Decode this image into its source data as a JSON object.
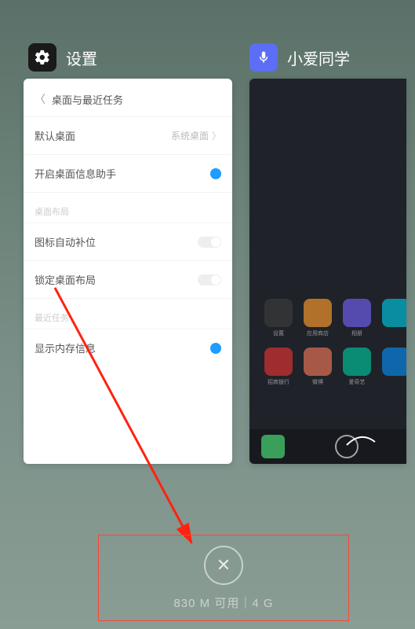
{
  "apps": {
    "left": {
      "name": "设置"
    },
    "right": {
      "name": "小爱同学"
    }
  },
  "settings": {
    "page_title": "桌面与最近任务",
    "default_desktop": {
      "label": "默认桌面",
      "value": "系统桌面"
    },
    "info_assistant": {
      "label": "开启桌面信息助手"
    },
    "section1": "桌面布局",
    "auto_fill": {
      "label": "图标自动补位"
    },
    "lock_layout": {
      "label": "锁定桌面布局"
    },
    "section2": "最近任务",
    "show_memory": {
      "label": "显示内存信息"
    }
  },
  "homescreen": {
    "icons": [
      {
        "label": "设置",
        "color": "#3a3a3a"
      },
      {
        "label": "应用商店",
        "color": "#f0932b"
      },
      {
        "label": "相册",
        "color": "#6c5ce7"
      },
      {
        "label": "",
        "color": "#00bcd4"
      },
      {
        "label": "招商银行",
        "color": "#d63031"
      },
      {
        "label": "微博",
        "color": "#e17055"
      },
      {
        "label": "爱奇艺",
        "color": "#00b894"
      },
      {
        "label": "",
        "color": "#0984e3"
      }
    ]
  },
  "footer": {
    "memory": "830 M 可用｜4 G"
  }
}
